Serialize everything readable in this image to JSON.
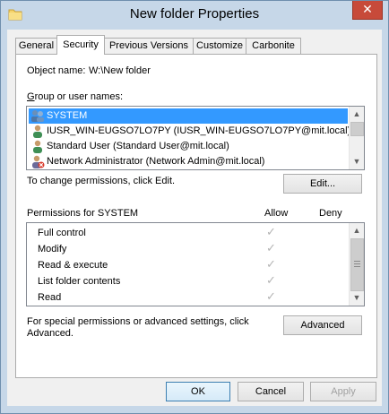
{
  "window": {
    "title": "New folder Properties",
    "close_glyph": "✕"
  },
  "tabs": [
    {
      "label": "General"
    },
    {
      "label": "Security",
      "active": true
    },
    {
      "label": "Previous Versions"
    },
    {
      "label": "Customize"
    },
    {
      "label": "Carbonite"
    }
  ],
  "security": {
    "object_name_label": "Object name:",
    "object_name_value": "W:\\New folder",
    "group_label": "Group or user names:",
    "users": [
      {
        "name": "SYSTEM",
        "icon": "group-users-icon",
        "selected": true
      },
      {
        "name": "IUSR_WIN-EUGSO7LO7PY (IUSR_WIN-EUGSO7LO7PY@mit.local)",
        "icon": "user-icon"
      },
      {
        "name": "Standard User (Standard User@mit.local)",
        "icon": "user-icon"
      },
      {
        "name": "Network Administrator (Network Admin@mit.local)",
        "icon": "user-denied-icon"
      }
    ],
    "change_hint": "To change permissions, click Edit.",
    "edit_button": "Edit...",
    "permissions_label": "Permissions for SYSTEM",
    "allow_header": "Allow",
    "deny_header": "Deny",
    "permissions": [
      {
        "name": "Full control",
        "allow": true
      },
      {
        "name": "Modify",
        "allow": true
      },
      {
        "name": "Read & execute",
        "allow": true
      },
      {
        "name": "List folder contents",
        "allow": true
      },
      {
        "name": "Read",
        "allow": true
      }
    ],
    "special_hint_line1": "For special permissions or advanced settings, click",
    "special_hint_line2": "Advanced.",
    "advanced_button": "Advanced"
  },
  "footer": {
    "ok": "OK",
    "cancel": "Cancel",
    "apply": "Apply"
  },
  "check_glyph": "✓",
  "colors": {
    "selection": "#3399ff",
    "frame": "#c6d7e8",
    "close": "#c74a3a"
  }
}
